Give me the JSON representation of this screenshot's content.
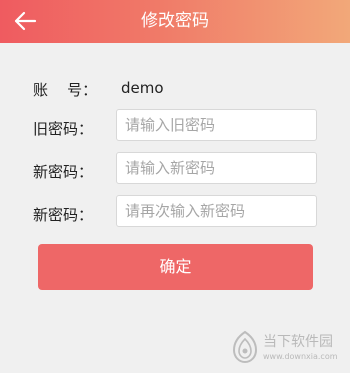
{
  "header": {
    "title": "修改密码",
    "back_icon": "arrow-left-icon"
  },
  "form": {
    "account_label": "账    号：",
    "account_value": "demo",
    "old_password_label": "旧密码：",
    "old_password_placeholder": "请输入旧密码",
    "new_password_label": "新密码：",
    "new_password_placeholder": "请输入新密码",
    "confirm_password_label": "新密码：",
    "confirm_password_placeholder": "请再次输入新密码"
  },
  "confirm_button": {
    "label": "确定"
  },
  "watermark": {
    "title": "当下软件园",
    "url": "www.downxia.com"
  },
  "colors": {
    "header_gradient_start": "#ef5b60",
    "header_gradient_end": "#f2a879",
    "button": "#ee6767",
    "background": "#f0f0f0"
  }
}
